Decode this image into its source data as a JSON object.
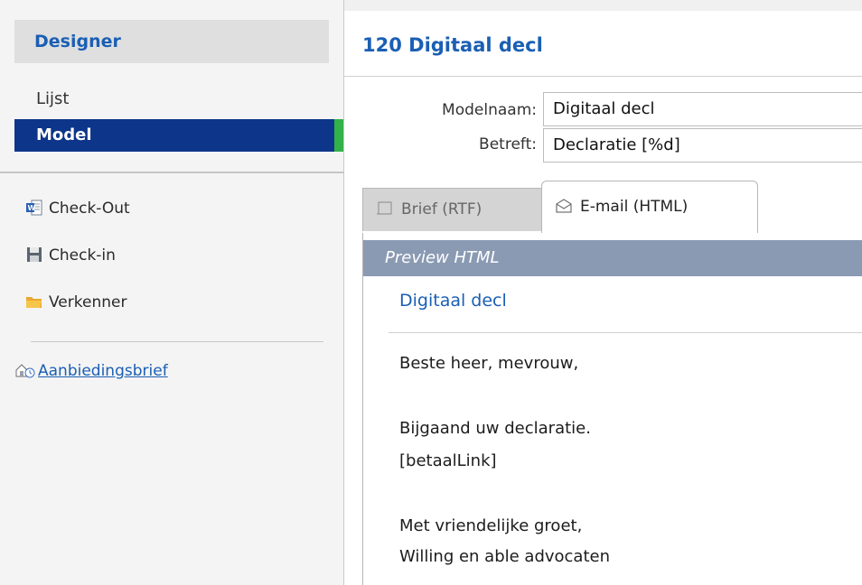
{
  "sidebar": {
    "header": "Designer",
    "nav": [
      {
        "label": "Lijst"
      },
      {
        "label": "Model"
      }
    ],
    "actions": [
      {
        "label": "Check-Out",
        "icon": "word-document-icon"
      },
      {
        "label": "Check-in",
        "icon": "floppy-disk-icon"
      },
      {
        "label": "Verkenner",
        "icon": "folder-icon"
      }
    ],
    "link": {
      "label": "Aanbiedingsbrief",
      "icon": "offer-letter-icon"
    }
  },
  "main": {
    "title": "120 Digitaal decl",
    "fields": {
      "modelnaam_label": "Modelnaam:",
      "modelnaam_value": "Digitaal decl",
      "betreft_label": "Betreft:",
      "betreft_value": "Declaratie [%d]"
    },
    "tabs": [
      {
        "label": "Brief  (RTF)",
        "icon": "document-icon"
      },
      {
        "label": "E-mail (HTML)",
        "icon": "envelope-icon"
      }
    ],
    "preview": {
      "bar_label": "Preview  HTML",
      "subject": "Digitaal decl",
      "lines": [
        "Beste heer, mevrouw,",
        "Bijgaand uw declaratie.",
        "[betaalLink]",
        "Met vriendelijke groet,",
        "Willing en able advocaten"
      ]
    }
  },
  "colors": {
    "accent_blue": "#1a5fb4",
    "selected_nav": "#0d3589",
    "selected_marker": "#33b24a",
    "preview_bar": "#8a9ab3"
  }
}
